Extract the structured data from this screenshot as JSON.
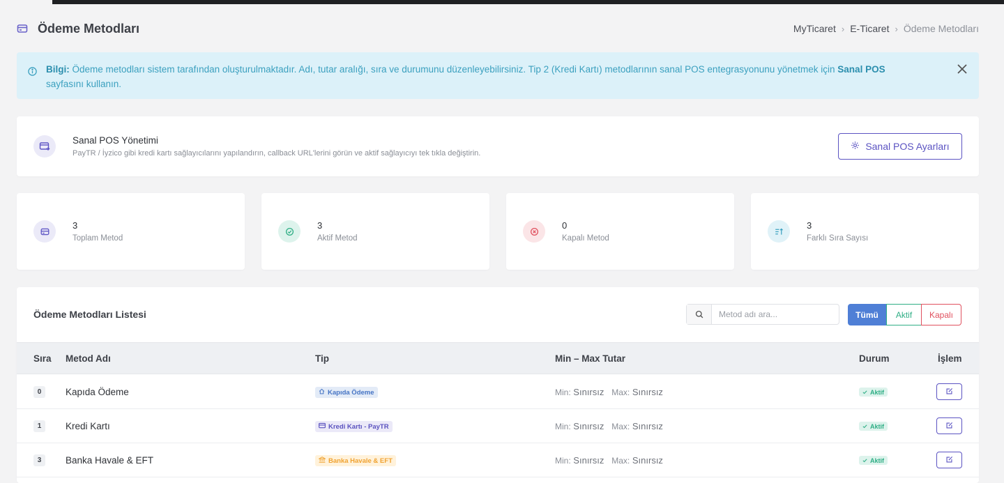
{
  "header": {
    "title": "Ödeme Metodları",
    "breadcrumb": [
      "MyTicaret",
      "E-Ticaret",
      "Ödeme Metodları"
    ]
  },
  "alert": {
    "prefix": "Bilgi:",
    "text": " Ödeme metodları sistem tarafından oluşturulmaktadır. Adı, tutar aralığı, sıra ve durumunu düzenleyebilirsiniz. Tip 2 (Kredi Kartı) metodlarının sanal POS entegrasyonunu yönetmek için ",
    "link": "Sanal POS",
    "suffix": " sayfasını kullanın."
  },
  "pos": {
    "title": "Sanal POS Yönetimi",
    "subtitle": "PayTR / İyzico gibi kredi kartı sağlayıcılarını yapılandırın, callback URL'lerini görün ve aktif sağlayıcıyı tek tıkla değiştirin.",
    "button": "Sanal POS Ayarları"
  },
  "stats": [
    {
      "value": "3",
      "label": "Toplam Metod",
      "icon": "card-icon",
      "color": "#5d55c4",
      "bg": "#ebeaf8"
    },
    {
      "value": "3",
      "label": "Aktif Metod",
      "icon": "check-circle-icon",
      "color": "#2fae85",
      "bg": "#ddf3ec"
    },
    {
      "value": "0",
      "label": "Kapalı Metod",
      "icon": "x-circle-icon",
      "color": "#e0505e",
      "bg": "#fbe5e7"
    },
    {
      "value": "3",
      "label": "Farklı Sıra Sayısı",
      "icon": "sort-icon",
      "color": "#3ba0bf",
      "bg": "#e0f2f8"
    }
  ],
  "list": {
    "title": "Ödeme Metodları Listesi",
    "search_placeholder": "Metod adı ara...",
    "filters": {
      "all": "Tümü",
      "active": "Aktif",
      "closed": "Kapalı"
    },
    "columns": {
      "sira": "Sıra",
      "name": "Metod Adı",
      "type": "Tip",
      "amount": "Min – Max Tutar",
      "status": "Durum",
      "action": "İşlem"
    },
    "rows": [
      {
        "sira": "0",
        "name": "Kapıda Ödeme",
        "type": "Kapıda Ödeme",
        "type_icon": "home-icon",
        "type_style": "blue",
        "min_label": "Min:",
        "min": "Sınırsız",
        "max_label": "Max:",
        "max": "Sınırsız",
        "status": "Aktif"
      },
      {
        "sira": "1",
        "name": "Kredi Kartı",
        "type": "Kredi Kartı - PayTR",
        "type_icon": "credit-card-icon",
        "type_style": "purple",
        "min_label": "Min:",
        "min": "Sınırsız",
        "max_label": "Max:",
        "max": "Sınırsız",
        "status": "Aktif"
      },
      {
        "sira": "3",
        "name": "Banka Havale & EFT",
        "type": "Banka Havale & EFT",
        "type_icon": "bank-icon",
        "type_style": "orange",
        "min_label": "Min:",
        "min": "Sınırsız",
        "max_label": "Max:",
        "max": "Sınırsız",
        "status": "Aktif"
      }
    ]
  }
}
